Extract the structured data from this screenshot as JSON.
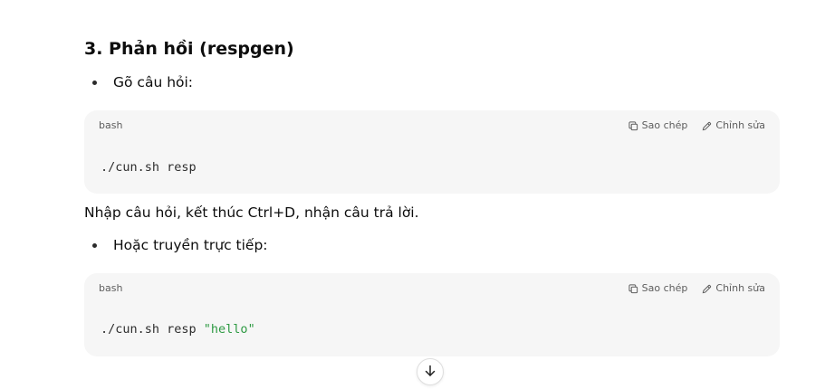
{
  "section": {
    "title": "3. Phản hồi (respgen)"
  },
  "bullets": [
    {
      "text": "Gõ câu hỏi:"
    },
    {
      "text": "Hoặc truyền trực tiếp:"
    }
  ],
  "paragraph": "Nhập câu hỏi, kết thúc Ctrl+D, nhận câu trả lời.",
  "code_blocks": [
    {
      "language": "bash",
      "copy_label": "Sao chép",
      "edit_label": "Chỉnh sửa",
      "code": "./cun.sh resp",
      "code_string": ""
    },
    {
      "language": "bash",
      "copy_label": "Sao chép",
      "edit_label": "Chỉnh sửa",
      "code": "./cun.sh resp ",
      "code_string": "\"hello\""
    }
  ],
  "icons": {
    "copy": "copy-icon",
    "edit": "edit-icon",
    "scroll": "arrow-down-icon"
  },
  "colors": {
    "code_background": "#f6f6f6",
    "string_literal": "#2e9a43",
    "muted_text": "#5d5d5d"
  }
}
